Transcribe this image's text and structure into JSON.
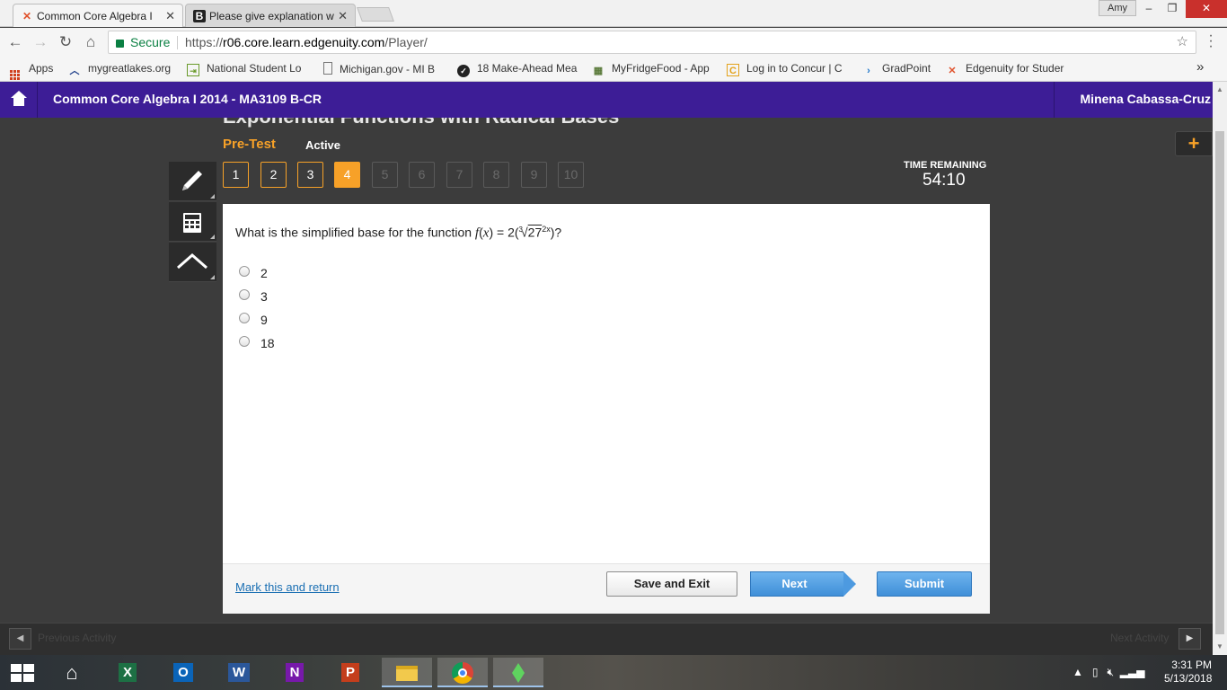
{
  "browser": {
    "tabs": [
      {
        "title": "Common Core Algebra I",
        "icon": "edgenuity-x-icon",
        "active": true
      },
      {
        "title": "Please give explanation w",
        "icon": "brainly-b-icon",
        "active": false
      }
    ],
    "window_user": "Amy",
    "secure_label": "Secure",
    "url_prefix": "https://",
    "url_host": "r06.core.learn.edgenuity.com",
    "url_path": "/Player/",
    "bookmarks": [
      {
        "label": "Apps",
        "icon": "apps-grid-icon"
      },
      {
        "label": "mygreatlakes.org",
        "icon": "mygreatlakes-icon"
      },
      {
        "label": "National Student Lo",
        "icon": "nslds-icon"
      },
      {
        "label": "Michigan.gov - MI B",
        "icon": "page-icon"
      },
      {
        "label": "18 Make-Ahead Mea",
        "icon": "check-circle-icon"
      },
      {
        "label": "MyFridgeFood - App",
        "icon": "fridge-icon"
      },
      {
        "label": "Log in to Concur | C",
        "icon": "concur-icon"
      },
      {
        "label": "GradPoint",
        "icon": "gradpoint-icon"
      },
      {
        "label": "Edgenuity for Studer",
        "icon": "edgenuity-x-icon"
      }
    ],
    "overflow": "»"
  },
  "app": {
    "course_title": "Common Core Algebra I 2014 - MA3109 B-CR",
    "user_name": "Minena Cabassa-Cruz",
    "lesson_title": "Exponential Functions with Radical Bases",
    "test_type": "Pre-Test",
    "status": "Active",
    "question_numbers": [
      {
        "n": "1",
        "state": "answered"
      },
      {
        "n": "2",
        "state": "answered"
      },
      {
        "n": "3",
        "state": "answered"
      },
      {
        "n": "4",
        "state": "current"
      },
      {
        "n": "5",
        "state": "disabled"
      },
      {
        "n": "6",
        "state": "disabled"
      },
      {
        "n": "7",
        "state": "disabled"
      },
      {
        "n": "8",
        "state": "disabled"
      },
      {
        "n": "9",
        "state": "disabled"
      },
      {
        "n": "10",
        "state": "disabled"
      }
    ],
    "timer_label": "TIME REMAINING",
    "timer_value": "54:10",
    "tools": [
      "pencil-icon",
      "calculator-icon",
      "reference-caret-icon"
    ],
    "expand_icon": "+",
    "question": {
      "prefix": "What is the simplified base for the function ",
      "fn_f": "f",
      "fn_x": "x",
      "equals": " = 2(",
      "root_index": "3",
      "radicand": "27",
      "exponent": "2x",
      "suffix": ")?"
    },
    "answers": [
      "2",
      "3",
      "9",
      "18"
    ],
    "mark_link": "Mark this and return",
    "save_exit_label": "Save and Exit",
    "next_label": "Next",
    "submit_label": "Submit",
    "prev_activity": "Previous Activity",
    "next_activity": "Next Activity",
    "accent_color": "#f7a128",
    "header_color": "#3d1d96",
    "button_blue": "#4d9ae0"
  },
  "taskbar": {
    "apps": [
      "windows-start-icon",
      "home-icon",
      "excel-icon",
      "outlook-icon",
      "word-icon",
      "onenote-icon",
      "powerpoint-icon",
      "file-explorer-icon",
      "chrome-icon",
      "sims-plumbob-icon"
    ],
    "time": "3:31 PM",
    "date": "5/13/2018"
  }
}
